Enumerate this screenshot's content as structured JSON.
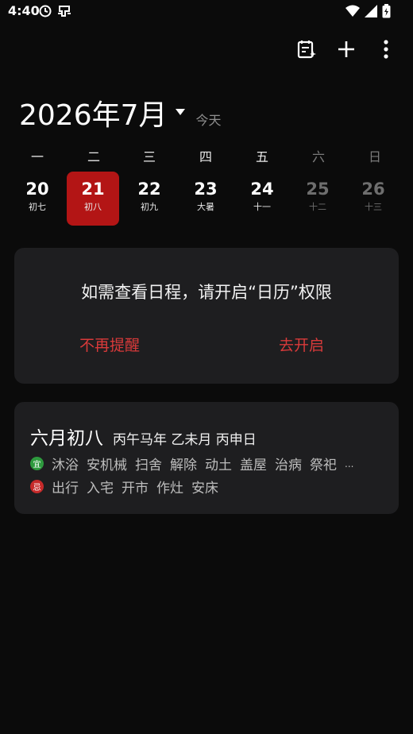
{
  "status_bar": {
    "time": "4:40",
    "left_icons": [
      "sync-icon",
      "bug-icon"
    ],
    "right_icons": [
      "wifi-icon",
      "signal-icon",
      "battery-icon"
    ]
  },
  "toolbar": {
    "icons": [
      "calendar-edit-icon",
      "add-icon",
      "more-icon"
    ]
  },
  "header": {
    "month_title": "2026年7月",
    "today_label": "今天"
  },
  "weekdays": [
    "一",
    "二",
    "三",
    "四",
    "五",
    "六",
    "日"
  ],
  "days": [
    {
      "num": "20",
      "lunar": "初七",
      "selected": false,
      "weekend": false
    },
    {
      "num": "21",
      "lunar": "初八",
      "selected": true,
      "weekend": false
    },
    {
      "num": "22",
      "lunar": "初九",
      "selected": false,
      "weekend": false
    },
    {
      "num": "23",
      "lunar": "大暑",
      "selected": false,
      "weekend": false
    },
    {
      "num": "24",
      "lunar": "十一",
      "selected": false,
      "weekend": false
    },
    {
      "num": "25",
      "lunar": "十二",
      "selected": false,
      "weekend": true
    },
    {
      "num": "26",
      "lunar": "十三",
      "selected": false,
      "weekend": true
    }
  ],
  "permission_card": {
    "message": "如需查看日程，请开启“日历”权限",
    "dismiss_label": "不再提醒",
    "open_label": "去开启"
  },
  "almanac": {
    "lunar_date": "六月初八",
    "ganzhi": "丙午马年 乙未月 丙申日",
    "good_badge": "宜",
    "good_items": [
      "沐浴",
      "安机械",
      "扫舍",
      "解除",
      "动土",
      "盖屋",
      "治病",
      "祭祀",
      "..."
    ],
    "bad_badge": "忌",
    "bad_items": [
      "出行",
      "入宅",
      "开市",
      "作灶",
      "安床"
    ]
  },
  "colors": {
    "background": "#0b0b0b",
    "card": "#1e1e20",
    "accent_red": "#b31515",
    "action_red": "#d93a3a",
    "good_green": "#2e9a3e"
  }
}
